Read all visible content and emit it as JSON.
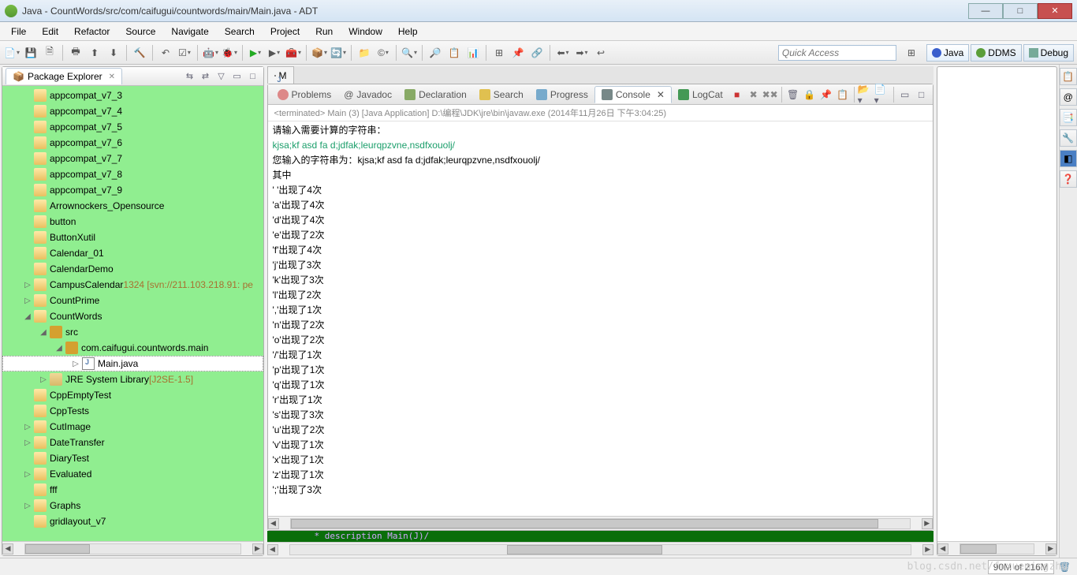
{
  "title": "Java - CountWords/src/com/caifugui/countwords/main/Main.java - ADT",
  "menubar": [
    "File",
    "Edit",
    "Refactor",
    "Source",
    "Navigate",
    "Search",
    "Project",
    "Run",
    "Window",
    "Help"
  ],
  "quick_access_placeholder": "Quick Access",
  "perspectives": [
    {
      "label": "Java",
      "active": true
    },
    {
      "label": "DDMS",
      "active": false
    },
    {
      "label": "Debug",
      "active": false
    }
  ],
  "package_explorer": {
    "title": "Package Explorer",
    "items": [
      {
        "label": "appcompat_v7_3",
        "type": "folder",
        "ind": 1
      },
      {
        "label": "appcompat_v7_4",
        "type": "folder",
        "ind": 1
      },
      {
        "label": "appcompat_v7_5",
        "type": "folder",
        "ind": 1
      },
      {
        "label": "appcompat_v7_6",
        "type": "folder",
        "ind": 1
      },
      {
        "label": "appcompat_v7_7",
        "type": "folder",
        "ind": 1
      },
      {
        "label": "appcompat_v7_8",
        "type": "folder",
        "ind": 1
      },
      {
        "label": "appcompat_v7_9",
        "type": "folder",
        "ind": 1
      },
      {
        "label": "Arrownockers_Opensource",
        "type": "folder",
        "ind": 1
      },
      {
        "label": "button",
        "type": "folder",
        "ind": 1
      },
      {
        "label": "ButtonXutil",
        "type": "folder",
        "ind": 1
      },
      {
        "label": "Calendar_01",
        "type": "folder",
        "ind": 1
      },
      {
        "label": "CalendarDemo",
        "type": "folder",
        "ind": 1
      },
      {
        "label": "CampusCalendar",
        "type": "proj",
        "ind": 1,
        "arrow": "▷",
        "rev": "1324 [svn://211.103.218.91: pe"
      },
      {
        "label": "CountPrime",
        "type": "proj",
        "ind": 1,
        "arrow": "▷"
      },
      {
        "label": "CountWords",
        "type": "proj",
        "ind": 1,
        "arrow": "◢"
      },
      {
        "label": "src",
        "type": "pkg",
        "ind": 2,
        "arrow": "◢"
      },
      {
        "label": "com.caifugui.countwords.main",
        "type": "pkg",
        "ind": 3,
        "arrow": "◢"
      },
      {
        "label": "Main.java",
        "type": "jfile",
        "ind": 4,
        "arrow": "▷",
        "selected": true
      },
      {
        "label": "JRE System Library",
        "type": "jar",
        "ind": 2,
        "arrow": "▷",
        "rev": "[J2SE-1.5]"
      },
      {
        "label": "CppEmptyTest",
        "type": "folder",
        "ind": 1
      },
      {
        "label": "CppTests",
        "type": "folder",
        "ind": 1
      },
      {
        "label": "CutImage",
        "type": "proj",
        "ind": 1,
        "arrow": "▷"
      },
      {
        "label": "DateTransfer",
        "type": "proj",
        "ind": 1,
        "arrow": "▷"
      },
      {
        "label": "DiaryTest",
        "type": "folder",
        "ind": 1
      },
      {
        "label": "Evaluated",
        "type": "proj",
        "ind": 1,
        "arrow": "▷"
      },
      {
        "label": "fff",
        "type": "folder",
        "ind": 1
      },
      {
        "label": "Graphs",
        "type": "proj",
        "ind": 1,
        "arrow": "▷"
      },
      {
        "label": "gridlayout_v7",
        "type": "folder",
        "ind": 1
      }
    ]
  },
  "editor_tab": {
    "label": "M"
  },
  "bottom_tabs": [
    {
      "label": "Problems",
      "icon": "ti-prob"
    },
    {
      "label": "Javadoc",
      "icon": "ti-doc",
      "prefix": "@"
    },
    {
      "label": "Declaration",
      "icon": "ti-decl"
    },
    {
      "label": "Search",
      "icon": "ti-search"
    },
    {
      "label": "Progress",
      "icon": "ti-prog"
    },
    {
      "label": "Console",
      "icon": "ti-cons",
      "active": true
    },
    {
      "label": "LogCat",
      "icon": "ti-log"
    }
  ],
  "console": {
    "launch": "<terminated> Main (3) [Java Application] D:\\编程\\JDK\\jre\\bin\\javaw.exe (2014年11月26日 下午3:04:25)",
    "lines": [
      {
        "t": "请输入需要计算的字符串：",
        "c": "out"
      },
      {
        "t": "kjsa;kf  asd fa d;jdfak;leurqpzvne,nsdfxouolj/",
        "c": "input-line"
      },
      {
        "t": "您输入的字符串为：kjsa;kf  asd fa d;jdfak;leurqpzvne,nsdfxouolj/",
        "c": "out"
      },
      {
        "t": "其中",
        "c": "out"
      },
      {
        "t": "' '出现了4次",
        "c": "out"
      },
      {
        "t": "'a'出现了4次",
        "c": "out"
      },
      {
        "t": "'d'出现了4次",
        "c": "out"
      },
      {
        "t": "'e'出现了2次",
        "c": "out"
      },
      {
        "t": "'f'出现了4次",
        "c": "out"
      },
      {
        "t": "'j'出现了3次",
        "c": "out"
      },
      {
        "t": "'k'出现了3次",
        "c": "out"
      },
      {
        "t": "'l'出现了2次",
        "c": "out"
      },
      {
        "t": "','出现了1次",
        "c": "out"
      },
      {
        "t": "'n'出现了2次",
        "c": "out"
      },
      {
        "t": "'o'出现了2次",
        "c": "out"
      },
      {
        "t": "'/'出现了1次",
        "c": "out"
      },
      {
        "t": "'p'出现了1次",
        "c": "out"
      },
      {
        "t": "'q'出现了1次",
        "c": "out"
      },
      {
        "t": "'r'出现了1次",
        "c": "out"
      },
      {
        "t": "'s'出现了3次",
        "c": "out"
      },
      {
        "t": "'u'出现了2次",
        "c": "out"
      },
      {
        "t": "'v'出现了1次",
        "c": "out"
      },
      {
        "t": "'x'出现了1次",
        "c": "out"
      },
      {
        "t": "'z'出现了1次",
        "c": "out"
      },
      {
        "t": "';'出现了3次",
        "c": "out"
      }
    ]
  },
  "green_strip": "* description Main(J)/",
  "status": {
    "heap": "90M of 216M"
  },
  "watermark": "blog.csdn.net/fuxuemingzhu"
}
